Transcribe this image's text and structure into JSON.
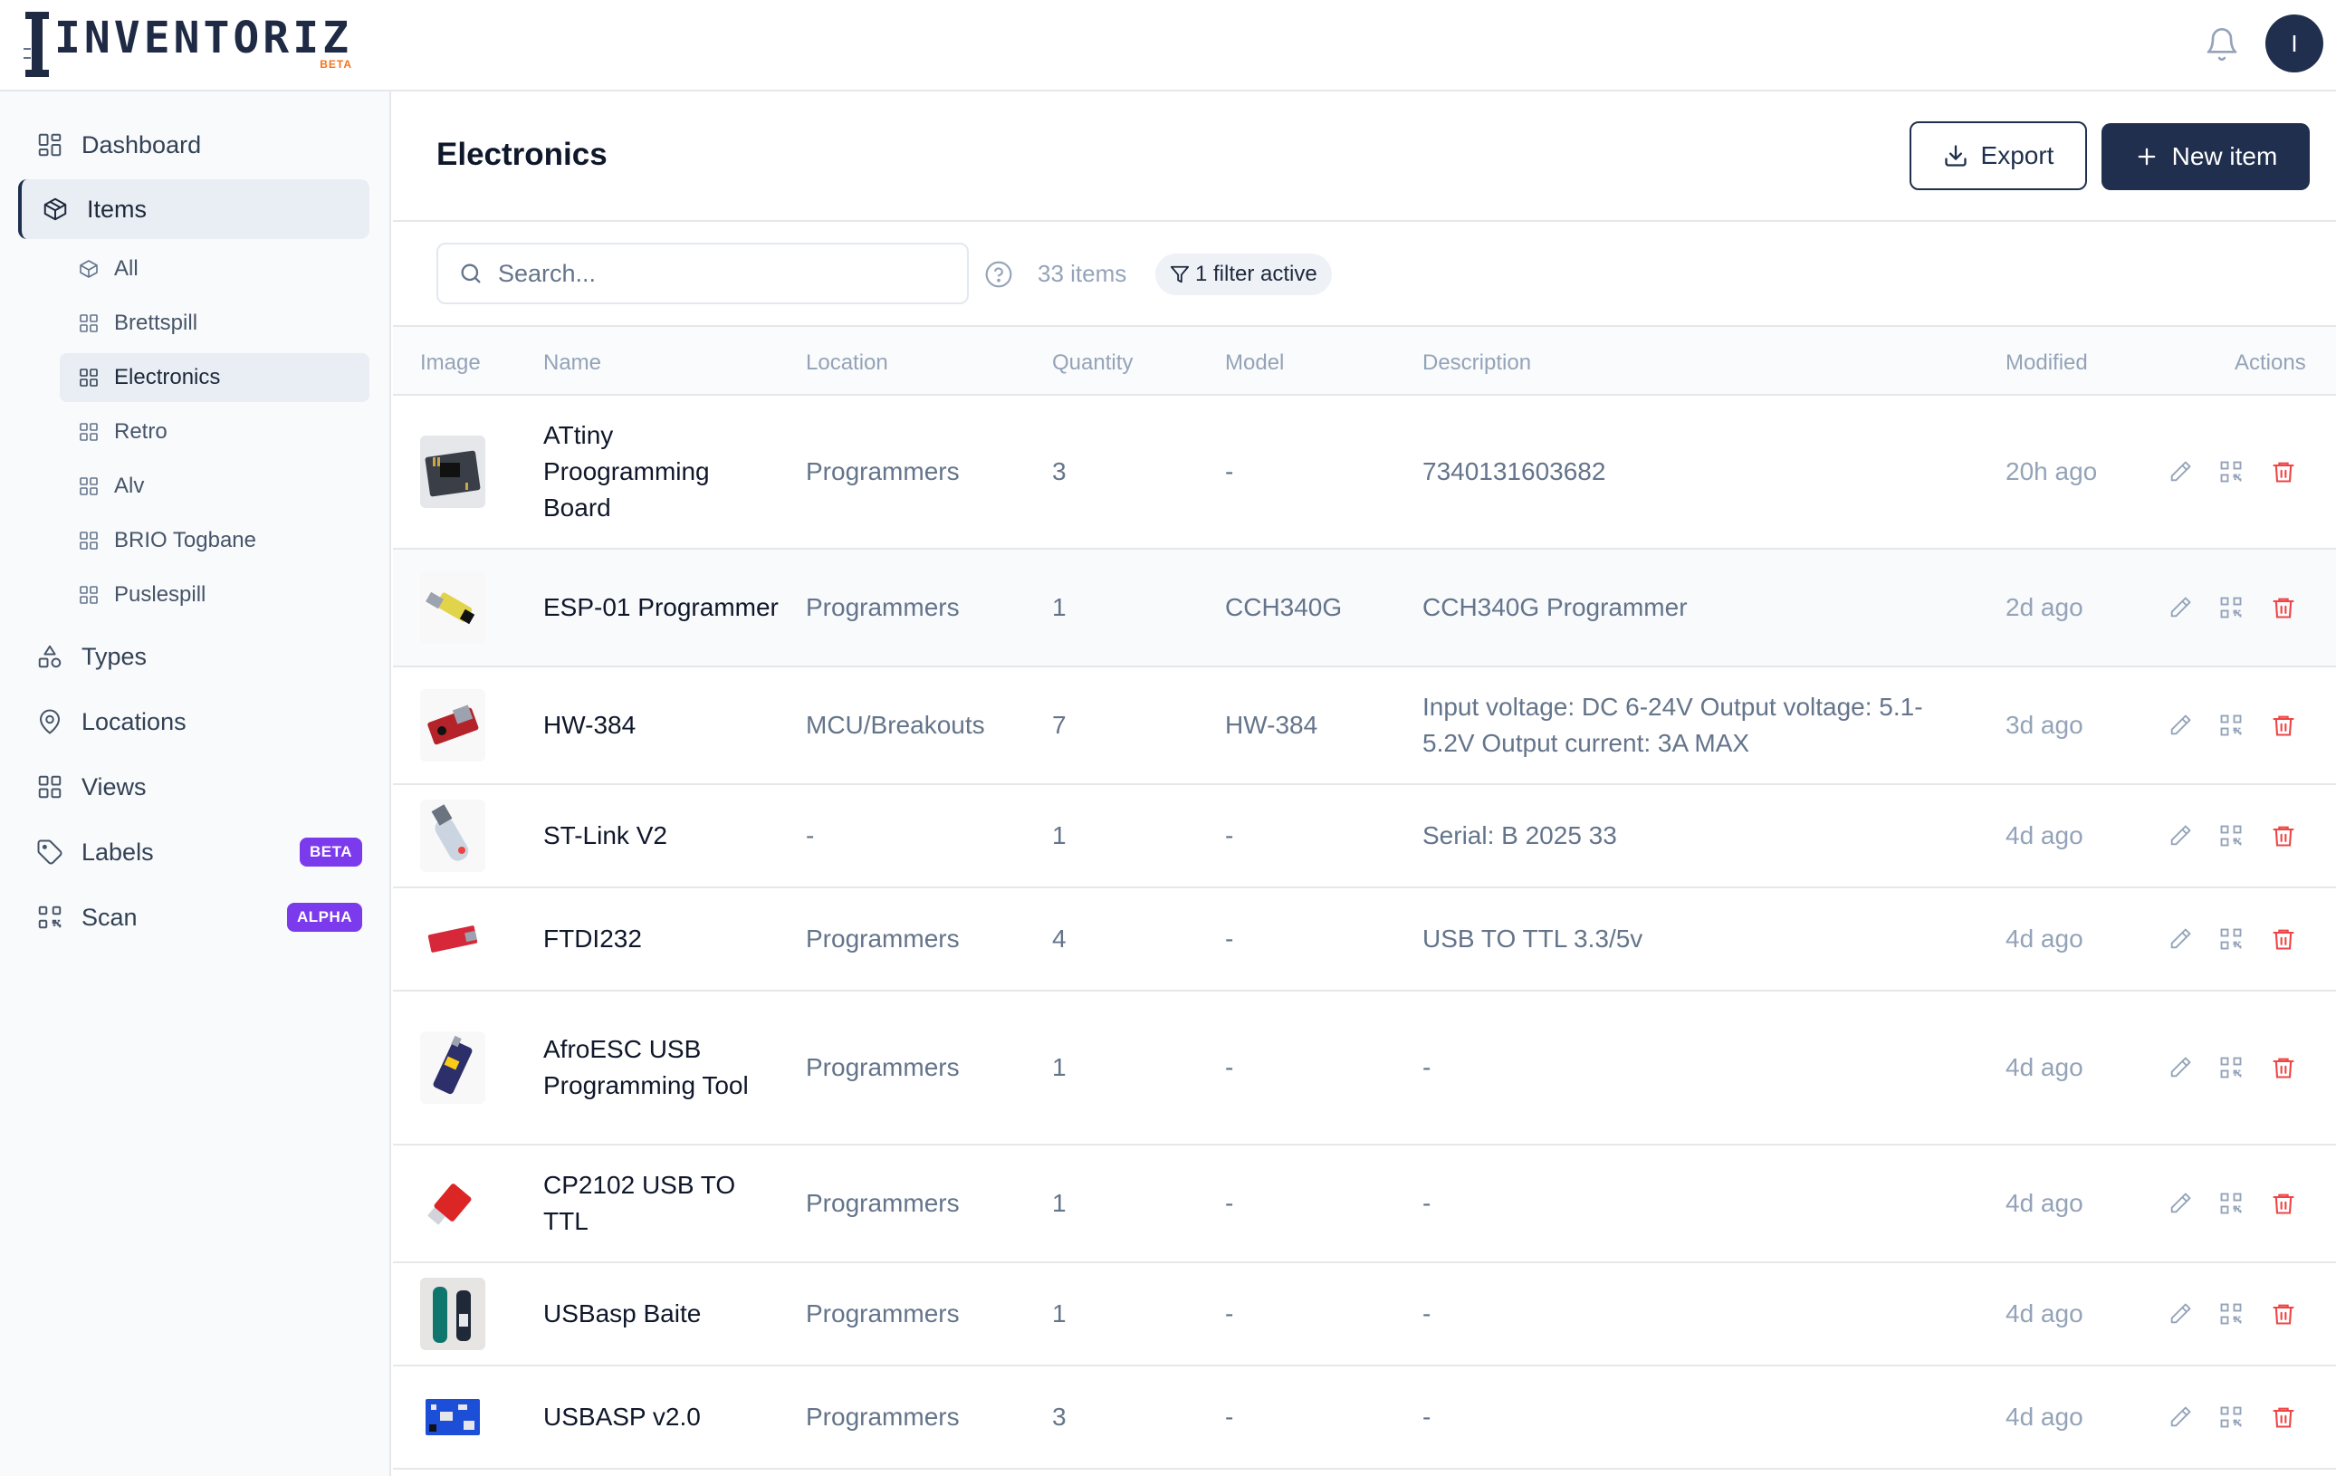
{
  "app": {
    "logo_text": "INVENTORIZ",
    "logo_badge": "BETA",
    "avatar_initial": "I"
  },
  "sidebar": {
    "main_items": [
      {
        "label": "Dashboard",
        "icon": "grid-icon"
      },
      {
        "label": "Items",
        "icon": "box-icon",
        "active": true
      },
      {
        "label": "Types",
        "icon": "shapes-icon"
      },
      {
        "label": "Locations",
        "icon": "map-pin-icon"
      },
      {
        "label": "Views",
        "icon": "grid-icon"
      },
      {
        "label": "Labels",
        "icon": "tag-icon",
        "badge": "BETA"
      },
      {
        "label": "Scan",
        "icon": "qr-icon",
        "badge": "ALPHA"
      }
    ],
    "sub_items": [
      {
        "label": "All",
        "icon": "box-icon"
      },
      {
        "label": "Brettspill",
        "icon": "grid-icon"
      },
      {
        "label": "Electronics",
        "icon": "grid-icon",
        "active": true
      },
      {
        "label": "Retro",
        "icon": "grid-icon"
      },
      {
        "label": "Alv",
        "icon": "grid-icon"
      },
      {
        "label": "BRIO Togbane",
        "icon": "grid-icon"
      },
      {
        "label": "Puslespill",
        "icon": "grid-icon"
      }
    ]
  },
  "main": {
    "title": "Electronics",
    "export_label": "Export",
    "new_item_label": "New item",
    "search_placeholder": "Search...",
    "item_count": "33 items",
    "filter_label": "1 filter active"
  },
  "table": {
    "columns": [
      "Image",
      "Name",
      "Location",
      "Quantity",
      "Model",
      "Description",
      "Modified",
      "Actions"
    ],
    "rows": [
      {
        "name": "ATtiny Proogramming Board",
        "location": "Programmers",
        "quantity": "3",
        "model": "-",
        "description": "7340131603682",
        "modified": "20h ago"
      },
      {
        "name": "ESP-01 Programmer",
        "location": "Programmers",
        "quantity": "1",
        "model": "CCH340G",
        "description": "CCH340G Programmer",
        "modified": "2d ago"
      },
      {
        "name": "HW-384",
        "location": "MCU/Breakouts",
        "quantity": "7",
        "model": "HW-384",
        "description": "Input voltage: DC 6-24V Output voltage: 5.1-5.2V Output current: 3A MAX",
        "modified": "3d ago"
      },
      {
        "name": "ST-Link V2",
        "location": "-",
        "quantity": "1",
        "model": "-",
        "description": "Serial: B 2025 33",
        "modified": "4d ago"
      },
      {
        "name": "FTDI232",
        "location": "Programmers",
        "quantity": "4",
        "model": "-",
        "description": "USB TO TTL 3.3/5v",
        "modified": "4d ago"
      },
      {
        "name": "AfroESC USB Programming Tool",
        "location": "Programmers",
        "quantity": "1",
        "model": "-",
        "description": "-",
        "modified": "4d ago"
      },
      {
        "name": "CP2102 USB TO TTL",
        "location": "Programmers",
        "quantity": "1",
        "model": "-",
        "description": "-",
        "modified": "4d ago"
      },
      {
        "name": "USBasp Baite",
        "location": "Programmers",
        "quantity": "1",
        "model": "-",
        "description": "-",
        "modified": "4d ago"
      },
      {
        "name": "USBASP v2.0",
        "location": "Programmers",
        "quantity": "3",
        "model": "-",
        "description": "-",
        "modified": "4d ago"
      }
    ]
  },
  "colors": {
    "primary": "#1f2f4d",
    "danger": "#ef4444",
    "badge": "#7c3aed",
    "logo_badge": "#f97316"
  }
}
